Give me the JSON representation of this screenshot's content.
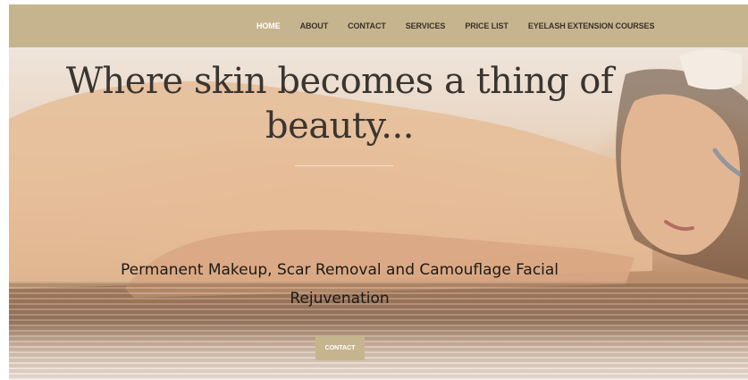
{
  "nav": {
    "items": [
      {
        "label": "HOME",
        "active": true
      },
      {
        "label": "ABOUT",
        "active": false
      },
      {
        "label": "CONTACT",
        "active": false
      },
      {
        "label": "SERVICES",
        "active": false
      },
      {
        "label": "PRICE LIST",
        "active": false
      },
      {
        "label": "EYELASH EXTENSION COURSES",
        "active": false
      }
    ]
  },
  "hero": {
    "headline": "Where skin becomes a thing of beauty...",
    "subheadline": "Permanent Makeup,  Scar Removal and Camouflage Facial Rejuvenation",
    "cta_label": "CONTACT"
  },
  "colors": {
    "accent": "#c6b48f",
    "headline": "#3a3530",
    "nav_text": "#3a3226",
    "nav_active": "#ffffff"
  }
}
